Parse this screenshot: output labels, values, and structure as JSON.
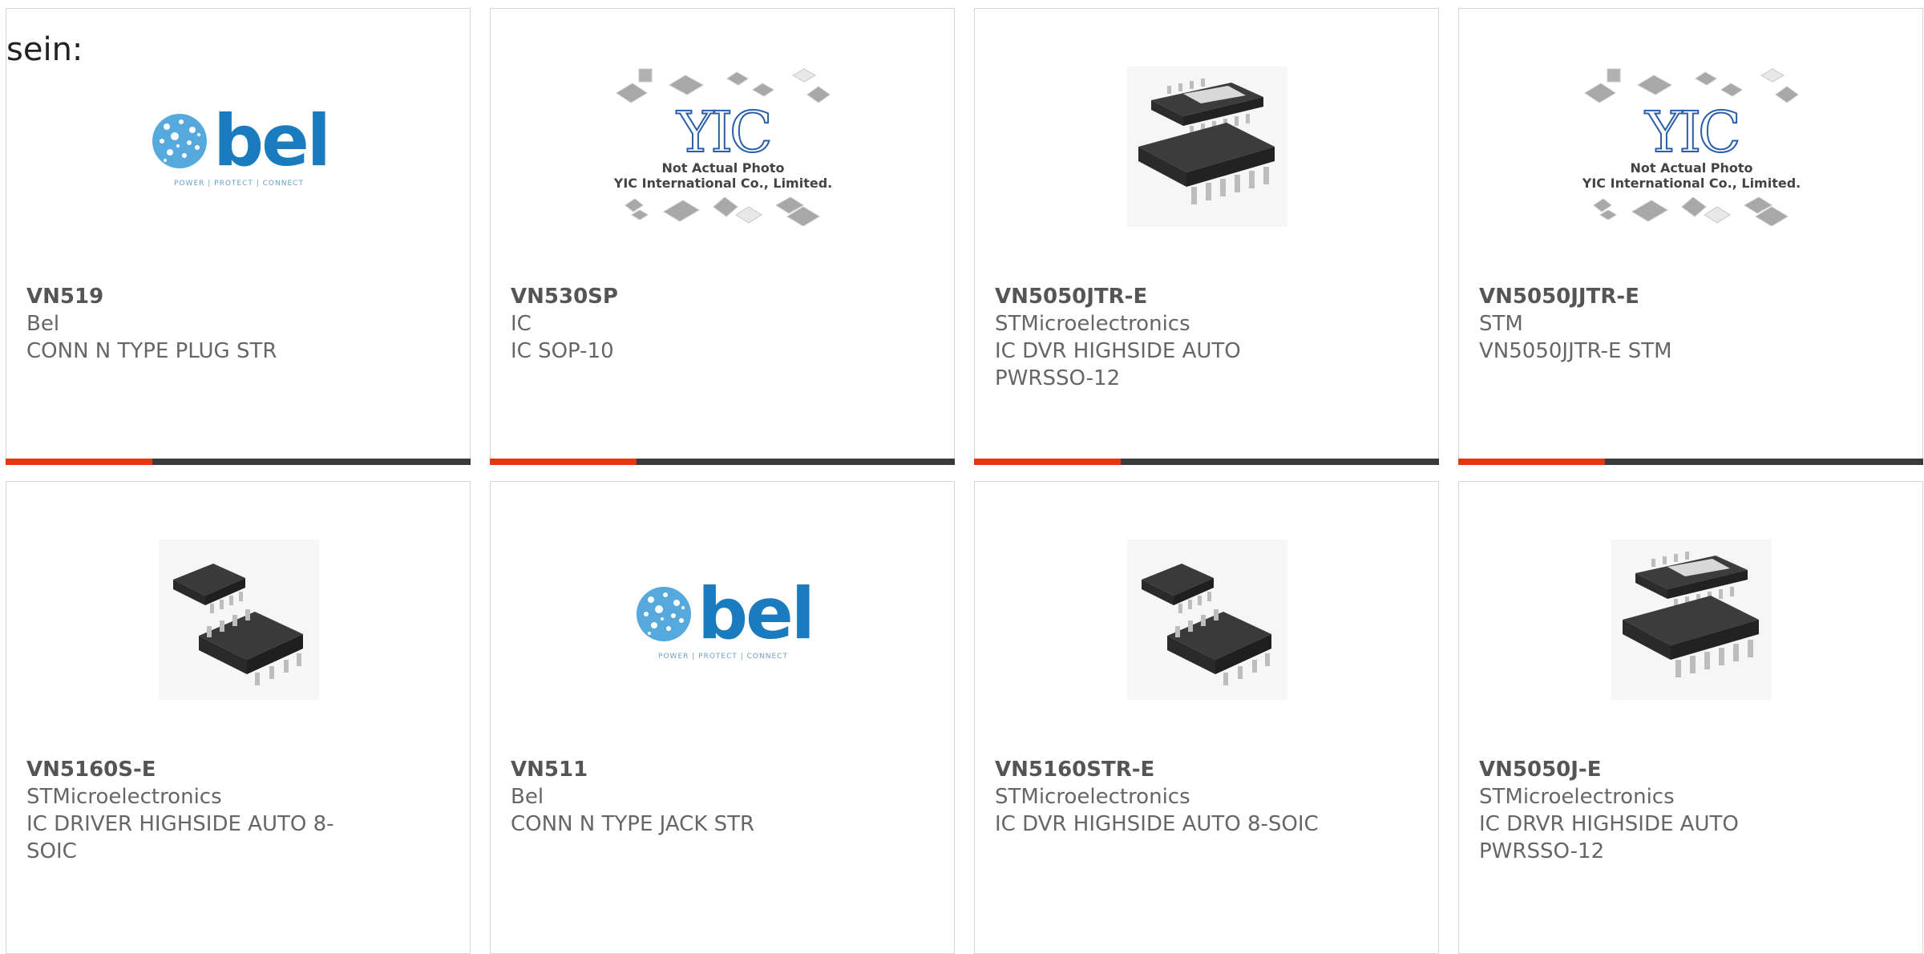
{
  "intro_text": "sein:",
  "products": [
    {
      "part": "VN519",
      "manufacturer": "Bel",
      "description": "CONN N TYPE PLUG STR",
      "image": "bel-logo",
      "logo_word": "bel",
      "logo_tagline": "POWER | PROTECT | CONNECT"
    },
    {
      "part": "VN530SP",
      "manufacturer": "IC",
      "description": "IC SOP-10",
      "image": "yic-placeholder",
      "logo_word": "YIC",
      "placeholder_line1": "Not Actual Photo",
      "placeholder_line2": "YIC International Co., Limited."
    },
    {
      "part": "VN5050JTR-E",
      "manufacturer": "STMicroelectronics",
      "description": "IC DVR HIGHSIDE AUTO PWRSSO-12",
      "image": "chip-pwrsso12"
    },
    {
      "part": "VN5050JJTR-E",
      "manufacturer": "STM",
      "description": "VN5050JJTR-E STM",
      "image": "yic-placeholder",
      "logo_word": "YIC",
      "placeholder_line1": "Not Actual Photo",
      "placeholder_line2": "YIC International Co., Limited."
    },
    {
      "part": "VN5160S-E",
      "manufacturer": "STMicroelectronics",
      "description": "IC DRIVER HIGHSIDE AUTO 8-SOIC",
      "image": "chip-soic8"
    },
    {
      "part": "VN511",
      "manufacturer": "Bel",
      "description": "CONN N TYPE JACK STR",
      "image": "bel-logo",
      "logo_word": "bel",
      "logo_tagline": "POWER | PROTECT | CONNECT"
    },
    {
      "part": "VN5160STR-E",
      "manufacturer": "STMicroelectronics",
      "description": "IC DVR HIGHSIDE AUTO 8-SOIC",
      "image": "chip-soic8"
    },
    {
      "part": "VN5050J-E",
      "manufacturer": "STMicroelectronics",
      "description": "IC DRVR HIGHSIDE AUTO PWRSSO-12",
      "image": "chip-pwrsso12"
    }
  ],
  "colors": {
    "accent": "#e63612",
    "bar": "#3a3a3a",
    "bel_blue": "#1a7bbf",
    "yic_blue": "#2a5fa8"
  }
}
